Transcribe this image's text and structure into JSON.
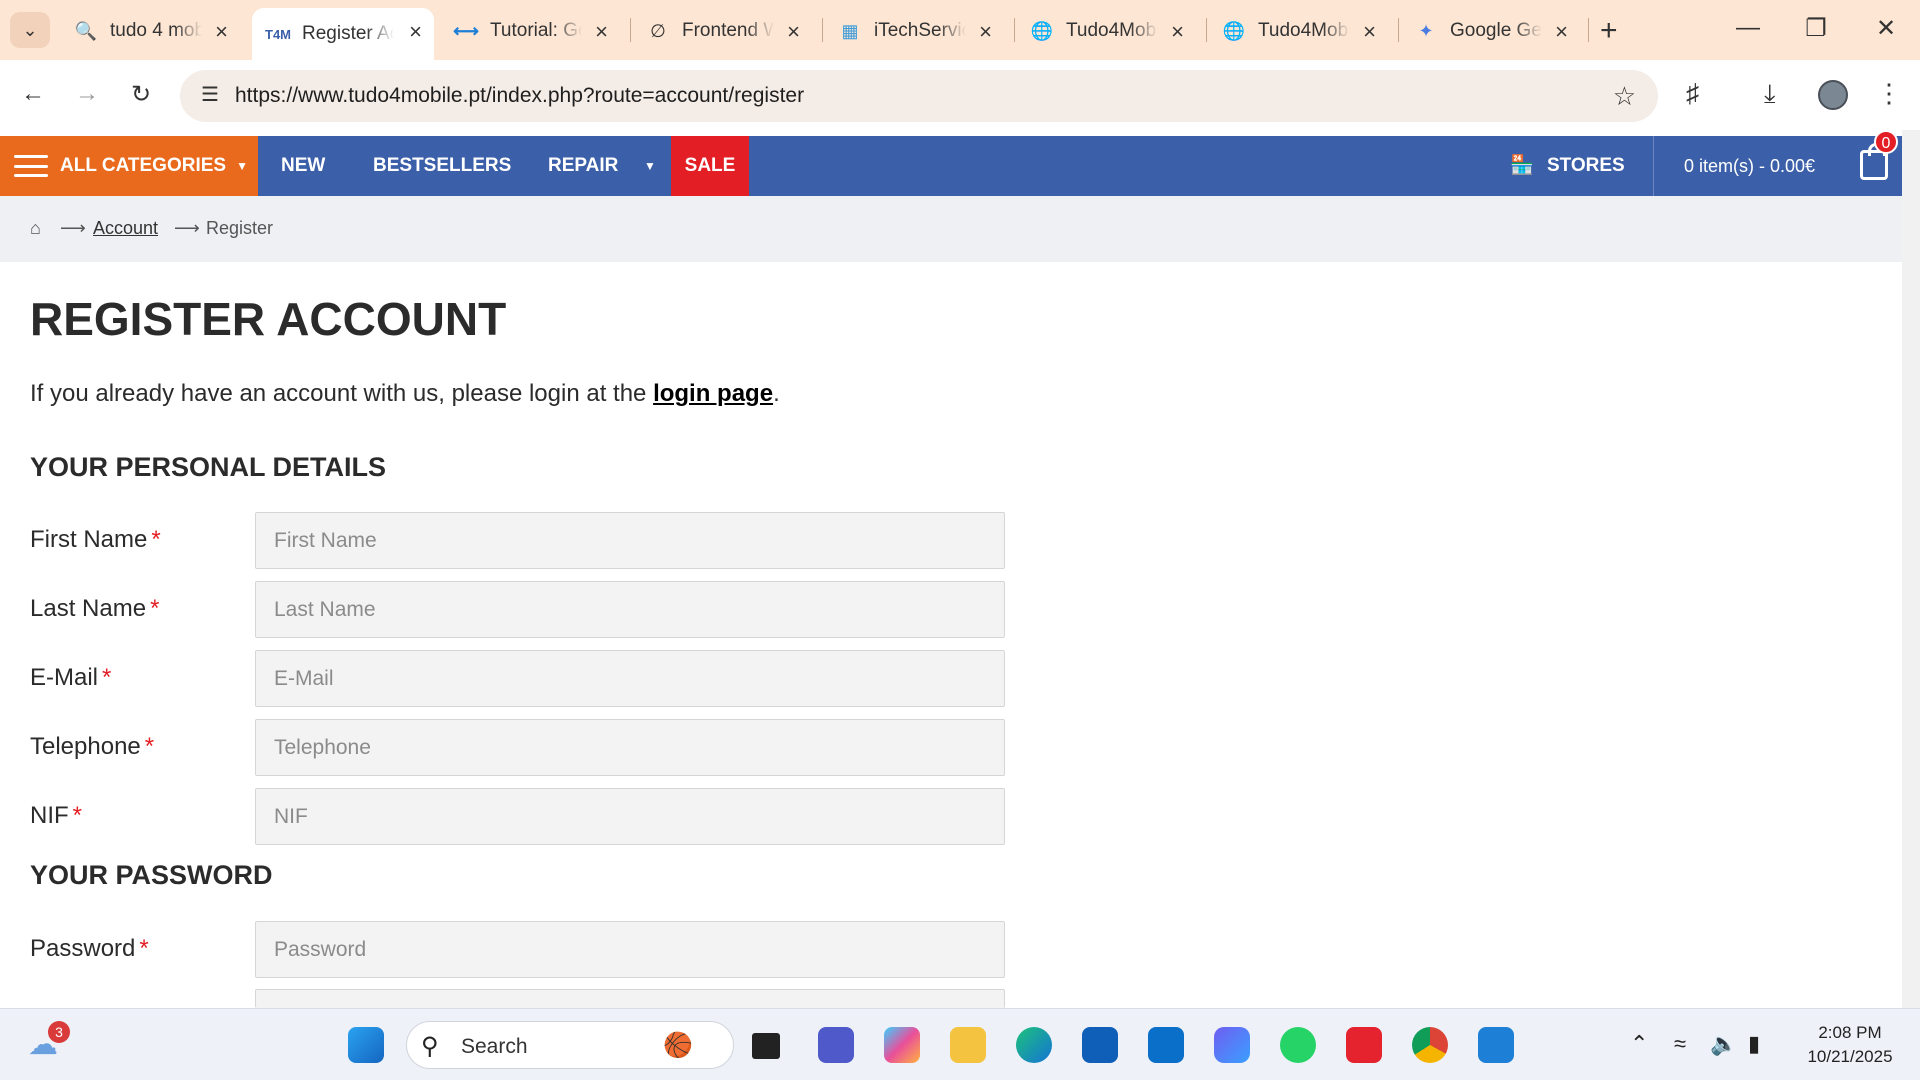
{
  "browser": {
    "tabs": [
      {
        "label": "tudo 4 mobile",
        "icon": "search-icon"
      },
      {
        "label": "Register Account",
        "icon": "t4m-logo-icon",
        "favicon_text": "T4M",
        "active": true
      },
      {
        "label": "Tutorial: Get",
        "icon": "vscode-icon"
      },
      {
        "label": "Frontend Web",
        "icon": "frontend-icon"
      },
      {
        "label": "iTechService",
        "icon": "itech-icon"
      },
      {
        "label": "Tudo4Mobile",
        "icon": "globe-icon"
      },
      {
        "label": "Tudo4Mobile",
        "icon": "globe-icon"
      },
      {
        "label": "Google Gemini",
        "icon": "gemini-icon"
      }
    ],
    "url": "https://www.tudo4mobile.pt/index.php?route=account/register"
  },
  "nav": {
    "all_categories": "ALL CATEGORIES",
    "new": "NEW",
    "bestsellers": "BESTSELLERS",
    "repair": "REPAIR",
    "sale": "SALE",
    "stores": "STORES",
    "cart": "0 item(s) - 0.00€",
    "cart_count": "0"
  },
  "breadcrumb": {
    "account": "Account",
    "register": "Register"
  },
  "page": {
    "title": "REGISTER ACCOUNT",
    "intro_prefix": "If you already have an account with us, please login at the ",
    "intro_link": "login page",
    "intro_suffix": "."
  },
  "personal": {
    "heading": "YOUR PERSONAL DETAILS",
    "fields": [
      {
        "label": "First Name",
        "placeholder": "First Name"
      },
      {
        "label": "Last Name",
        "placeholder": "Last Name"
      },
      {
        "label": "E-Mail",
        "placeholder": "E-Mail"
      },
      {
        "label": "Telephone",
        "placeholder": "Telephone"
      },
      {
        "label": "NIF",
        "placeholder": "NIF"
      }
    ]
  },
  "password": {
    "heading": "YOUR PASSWORD",
    "fields": [
      {
        "label": "Password",
        "placeholder": "Password"
      }
    ]
  },
  "required_mark": "*",
  "taskbar": {
    "search_label": "Search",
    "weather_badge": "3",
    "time": "2:08 PM",
    "date": "10/21/2025"
  },
  "colors": {
    "nav_blue": "#3b60a9",
    "categories_orange": "#ea6a1d",
    "sale_red": "#e31e24"
  }
}
